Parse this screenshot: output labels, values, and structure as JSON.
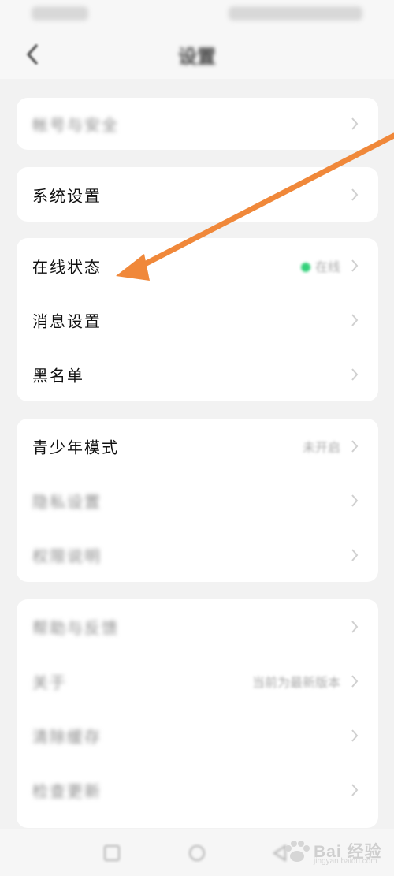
{
  "status_bar": {
    "left_text": "",
    "right_text": ""
  },
  "header": {
    "title": "设置"
  },
  "groups": [
    {
      "items": [
        {
          "label": "帐号与安全",
          "blurred": true
        }
      ]
    },
    {
      "items": [
        {
          "label": "系统设置",
          "blurred": false
        }
      ]
    },
    {
      "items": [
        {
          "label": "在线状态",
          "blurred": false,
          "value": "在线",
          "status_dot": true
        },
        {
          "label": "消息设置",
          "blurred": false
        },
        {
          "label": "黑名单",
          "blurred": false
        }
      ]
    },
    {
      "items": [
        {
          "label": "青少年模式",
          "blurred": false,
          "value": "未开启"
        },
        {
          "label": "隐私设置",
          "blurred": true
        },
        {
          "label": "权限说明",
          "blurred": true
        }
      ]
    },
    {
      "items": [
        {
          "label": "帮助与反馈",
          "blurred": true
        },
        {
          "label": "关于",
          "blurred": true,
          "value": "当前为最新版本"
        },
        {
          "label": "清除缓存",
          "blurred": true
        },
        {
          "label": "检查更新",
          "blurred": true
        }
      ]
    }
  ],
  "annotation": {
    "color": "#f0883a"
  },
  "watermark": {
    "brand": "Bai 经验",
    "url": "jingyan.baidu.com"
  },
  "colors": {
    "background": "#f2f2f2",
    "card": "#ffffff",
    "online": "#33d17a"
  }
}
